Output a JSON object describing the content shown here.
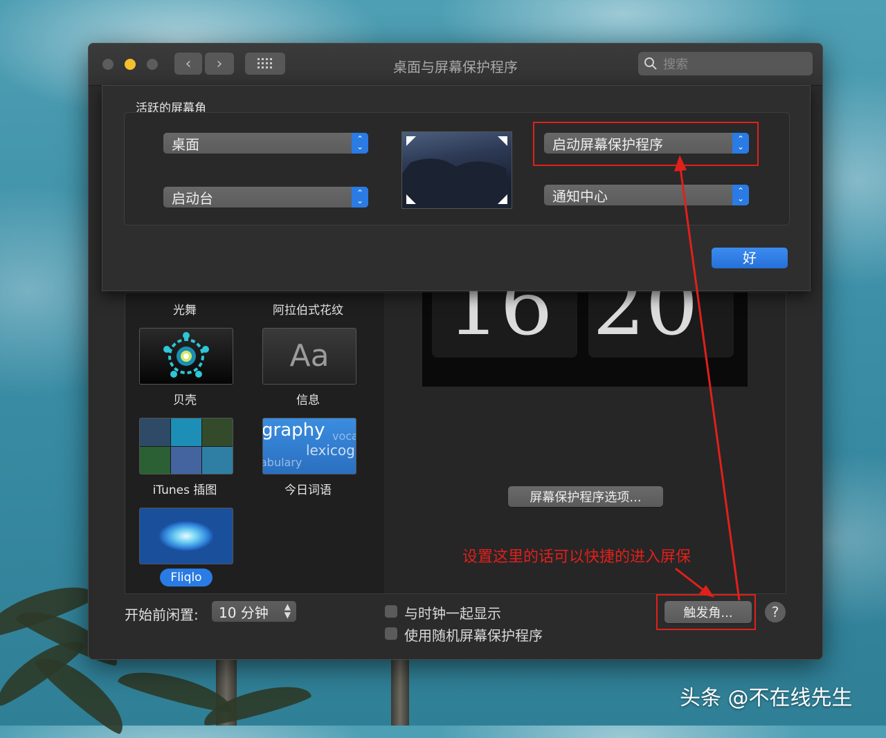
{
  "window": {
    "title": "桌面与屏幕保护程序",
    "search_placeholder": "搜索"
  },
  "sheet": {
    "heading": "活跃的屏幕角",
    "corners": {
      "top_left": "桌面",
      "bottom_left": "启动台",
      "top_right": "启动屏幕保护程序",
      "bottom_right": "通知中心"
    },
    "ok_label": "好"
  },
  "savers": [
    {
      "label": "光舞"
    },
    {
      "label": "阿拉伯式花纹"
    },
    {
      "label": "贝壳"
    },
    {
      "label": "信息",
      "thumb_text": "Aa"
    },
    {
      "label": "iTunes 插图"
    },
    {
      "label": "今日词语",
      "thumb_lines": [
        "graphy",
        "voca",
        "lexicog",
        "abulary"
      ]
    },
    {
      "label": "Fliqlo",
      "selected": true
    }
  ],
  "preview": {
    "hour": "16",
    "minute": "20",
    "options_label": "屏幕保护程序选项..."
  },
  "bottom": {
    "idle_label": "开始前闲置:",
    "idle_value": "10 分钟",
    "show_clock_label": "与时钟一起显示",
    "random_label": "使用随机屏幕保护程序",
    "hot_corners_label": "触发角...",
    "help_label": "?"
  },
  "annotation": {
    "text": "设置这里的话可以快捷的进入屏保",
    "color": "#e0201b"
  },
  "watermark": "头条 @不在线先生"
}
